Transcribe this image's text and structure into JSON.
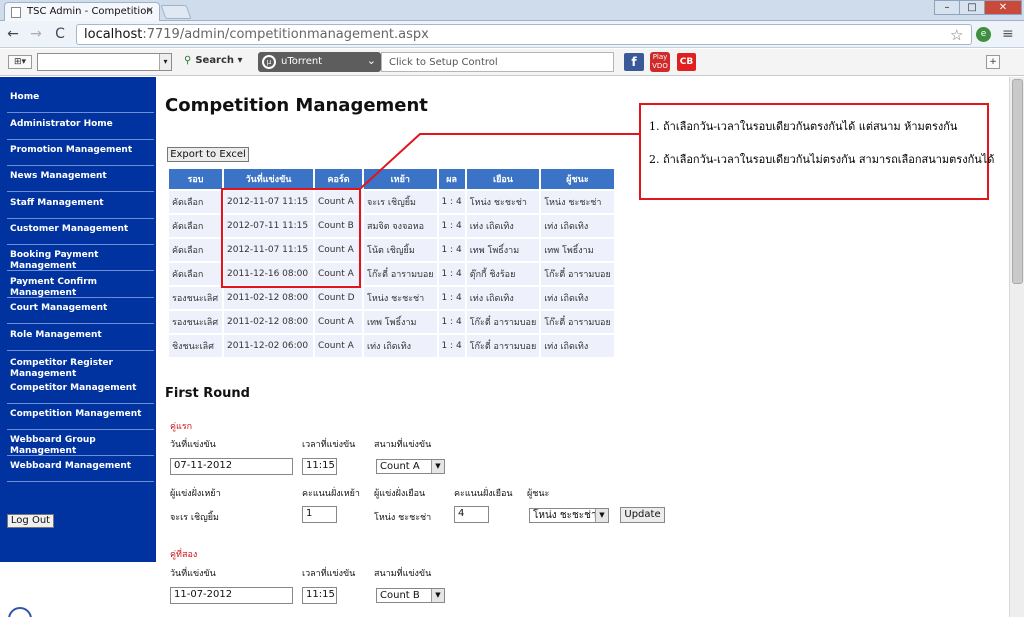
{
  "browser": {
    "tab_title": "TSC Admin - Competition",
    "tab_close": "×",
    "url_host": "localhost",
    "url_path": ":7719/admin/competitionmanagement.aspx",
    "window_min": "–",
    "window_max": "□",
    "window_close": "✕",
    "back_icon": "←",
    "forward_icon": "→",
    "reload_icon": "C",
    "star_icon": "☆",
    "wrench_icon": "≡"
  },
  "toolbar": {
    "search_label": "Search",
    "search_arrow": "▾",
    "utorrent_label": "uTorrent",
    "setup_text": "Click to Setup Control",
    "fb_label": "f",
    "play_label": "Play VDO",
    "cb_label": "CB",
    "plus_label": "⊞▾",
    "right_icon": "+"
  },
  "sidebar": {
    "items": [
      {
        "label": "Home"
      },
      {
        "label": "Administrator Home"
      },
      {
        "label": "Promotion Management"
      },
      {
        "label": "News Management"
      },
      {
        "label": "Staff Management"
      },
      {
        "label": "Customer Management"
      },
      {
        "label": "Booking Payment Management"
      },
      {
        "label": "Payment Confirm Management"
      },
      {
        "label": "Court Management"
      },
      {
        "label": "Role Management"
      },
      {
        "label": "Competitor Register Management"
      },
      {
        "label": "Competitor Management"
      },
      {
        "label": "Competition Management"
      },
      {
        "label": "Webboard Group Management"
      },
      {
        "label": "Webboard Management"
      }
    ],
    "logout_label": "Log Out"
  },
  "main": {
    "title": "Competition Management",
    "export_label": "Export to Excel",
    "table": {
      "headers": [
        "รอบ",
        "วันที่แข่งขัน",
        "คอร์ด",
        "เหย้า",
        "ผล",
        "เยือน",
        "ผู้ชนะ"
      ],
      "rows": [
        [
          "คัดเลือก",
          "2012-11-07 11:15",
          "Count A",
          "จะเร เชิญยิ้ม",
          "1 : 4",
          "โหน่ง ชะชะช่า",
          "โหน่ง ชะชะช่า"
        ],
        [
          "คัดเลือก",
          "2012-07-11 11:15",
          "Count B",
          "สมจิต จงจอหอ",
          "1 : 4",
          "เท่ง เถิดเทิง",
          "เท่ง เถิดเทิง"
        ],
        [
          "คัดเลือก",
          "2012-11-07 11:15",
          "Count A",
          "โน้ต เชิญยิ้ม",
          "1 : 4",
          "เทพ โพธิ์งาม",
          "เทพ โพธิ์งาม"
        ],
        [
          "คัดเลือก",
          "2011-12-16 08:00",
          "Count A",
          "โก๊ะตี๋ อารามบอย",
          "1 : 4",
          "ตุ๊กกี้ ชิงร้อย",
          "โก๊ะตี๋ อารามบอย"
        ],
        [
          "รองชนะเลิศ",
          "2011-02-12 08:00",
          "Count D",
          "โหน่ง ชะชะช่า",
          "1 : 4",
          "เท่ง เถิดเทิง",
          "เท่ง เถิดเทิง"
        ],
        [
          "รองชนะเลิศ",
          "2011-02-12 08:00",
          "Count A",
          "เทพ โพธิ์งาม",
          "1 : 4",
          "โก๊ะตี๋ อารามบอย",
          "โก๊ะตี๋ อารามบอย"
        ],
        [
          "ชิงชนะเลิศ",
          "2011-12-02 06:00",
          "Count A",
          "เท่ง เถิดเทิง",
          "1 : 4",
          "โก๊ะตี๋ อารามบอย",
          "เท่ง เถิดเทิง"
        ]
      ]
    },
    "notes": [
      "1. ถ้าเลือกวัน-เวลาในรอบเดียวกันตรงกันได้ แต่สนาม ห้ามตรงกัน",
      "2. ถ้าเลือกวัน-เวลาในรอบเดียวกันไม่ตรงกัน สามารถเลือกสนามตรงกันได้"
    ],
    "first_round": {
      "title": "First Round",
      "labels": {
        "date": "วันที่แข่งขัน",
        "time": "เวลาที่แข่งขัน",
        "court": "สนามที่แข่งขัน",
        "home_player": "ผู้แข่งฝั่งเหย้า",
        "home_score": "คะแนนฝั่งเหย้า",
        "away_player": "ผู้แข่งฝั่งเยือน",
        "away_score": "คะแนนฝั่งเยือน",
        "winner": "ผู้ชนะ"
      },
      "match1": {
        "label": "คู่แรก",
        "date": "07-11-2012",
        "time": "11:15",
        "court": "Count A",
        "home_player": "จะเร เชิญยิ้ม",
        "home_score": "1",
        "away_player": "โหน่ง ชะชะช่า",
        "away_score": "4",
        "winner": "โหน่ง ชะชะช่า",
        "update_label": "Update"
      },
      "match2": {
        "label": "คู่ที่สอง",
        "date": "11-07-2012",
        "time": "11:15",
        "court": "Count B"
      }
    }
  },
  "colors": {
    "sidebar_bg": "#0033a0",
    "table_header": "#3b73c7",
    "callout_red": "#e3141b"
  }
}
